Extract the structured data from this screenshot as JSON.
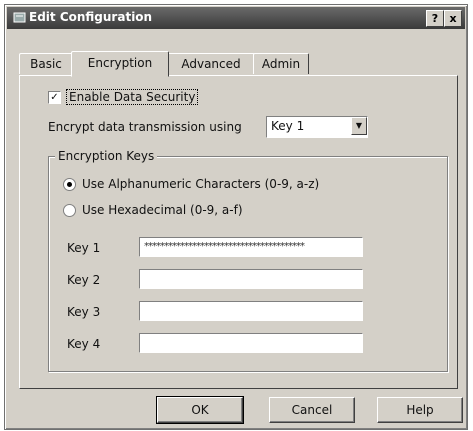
{
  "window": {
    "title": "Edit Configuration",
    "help_label": "?",
    "close_label": "x"
  },
  "tabs": [
    {
      "label": "Basic"
    },
    {
      "label": "Encryption"
    },
    {
      "label": "Advanced"
    },
    {
      "label": "Admin"
    }
  ],
  "encryption": {
    "enable_label": "Enable Data Security",
    "enable_checked": "✓",
    "encrypt_label": "Encrypt data transmission using",
    "encrypt_value": "Key 1",
    "group_title": "Encryption Keys",
    "radio_alnum_label": "Use Alphanumeric Characters (0-9, a-z)",
    "radio_hex_label": "Use Hexadecimal (0-9, a-f)",
    "keys": [
      {
        "label": "Key 1",
        "value": "****************************************"
      },
      {
        "label": "Key 2",
        "value": ""
      },
      {
        "label": "Key 3",
        "value": ""
      },
      {
        "label": "Key 4",
        "value": ""
      }
    ]
  },
  "buttons": {
    "ok": "OK",
    "cancel": "Cancel",
    "help": "Help"
  }
}
